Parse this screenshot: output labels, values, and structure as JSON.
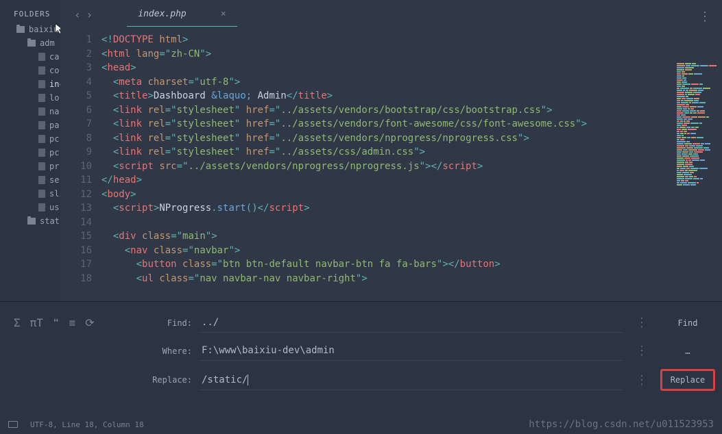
{
  "sidebar": {
    "header": "FOLDERS",
    "items": [
      {
        "type": "folder",
        "name": "baixiu-",
        "depth": 0
      },
      {
        "type": "folder",
        "name": "adm",
        "depth": 1
      },
      {
        "type": "file",
        "name": "ca",
        "depth": 2
      },
      {
        "type": "file",
        "name": "co",
        "depth": 2
      },
      {
        "type": "file",
        "name": "inc",
        "depth": 2,
        "active": true
      },
      {
        "type": "file",
        "name": "lo",
        "depth": 2
      },
      {
        "type": "file",
        "name": "na",
        "depth": 2
      },
      {
        "type": "file",
        "name": "pa",
        "depth": 2
      },
      {
        "type": "file",
        "name": "pc",
        "depth": 2
      },
      {
        "type": "file",
        "name": "pc",
        "depth": 2
      },
      {
        "type": "file",
        "name": "pr",
        "depth": 2
      },
      {
        "type": "file",
        "name": "se",
        "depth": 2
      },
      {
        "type": "file",
        "name": "sli",
        "depth": 2
      },
      {
        "type": "file",
        "name": "us",
        "depth": 2
      },
      {
        "type": "folder",
        "name": "stat",
        "depth": 1
      }
    ]
  },
  "tab": {
    "name": "index.php",
    "close": "×"
  },
  "nav": {
    "back": "‹",
    "forward": "›"
  },
  "code_lines": 18,
  "find": {
    "find_label": "Find:",
    "find_value": "../",
    "where_label": "Where:",
    "where_value": "F:\\www\\baixiu-dev\\admin",
    "replace_label": "Replace:",
    "replace_value": "/static/",
    "find_btn": "Find",
    "where_btn": "…",
    "replace_btn": "Replace"
  },
  "tools": {
    "sigma": "Σ",
    "text": "πT",
    "quote": "❝",
    "list": "≡",
    "refresh": "⟳"
  },
  "status": {
    "encoding": "UTF-8, Line 18, Column 18"
  },
  "watermark": "https://blog.csdn.net/u011523953",
  "chart_data": null
}
